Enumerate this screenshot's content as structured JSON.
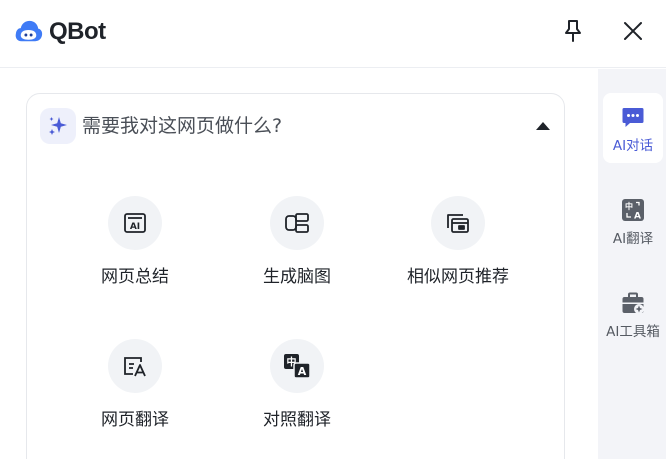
{
  "header": {
    "brand": "QBot",
    "icons": {
      "logo": "qbot-logo-icon",
      "pin": "pin-icon",
      "close": "close-icon"
    }
  },
  "card": {
    "question": "需要我对这网页做什么?",
    "icons": {
      "sparkle": "sparkle-icon",
      "collapse": "caret-up-icon"
    },
    "actions": [
      {
        "label": "网页总结",
        "icon": "ai-summary-icon"
      },
      {
        "label": "生成脑图",
        "icon": "mind-map-icon"
      },
      {
        "label": "相似网页推荐",
        "icon": "similar-pages-icon"
      },
      {
        "label": "网页翻译",
        "icon": "page-translate-icon"
      },
      {
        "label": "对照翻译",
        "icon": "bilingual-translate-icon"
      }
    ]
  },
  "sidebar": {
    "items": [
      {
        "label": "AI对话",
        "icon": "chat-icon",
        "active": true
      },
      {
        "label": "AI翻译",
        "icon": "translate-icon",
        "active": false
      },
      {
        "label": "AI工具箱",
        "icon": "toolbox-icon",
        "active": false
      }
    ]
  },
  "colors": {
    "accent": "#4a5bd6",
    "logo_blue": "#3f7bf6",
    "sidebar_bg": "#f3f4f8",
    "icon_circle_bg": "#f1f3f6",
    "text": "#1f2329"
  }
}
